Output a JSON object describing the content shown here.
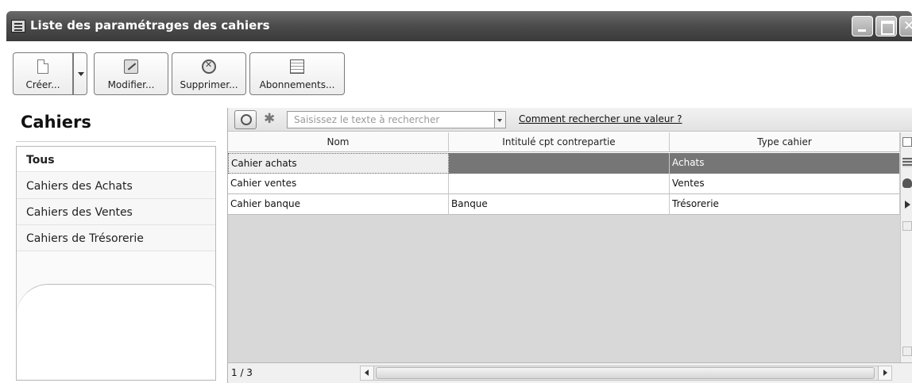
{
  "window": {
    "title": "Liste des paramétrages des cahiers"
  },
  "toolbar": {
    "create_label": "Créer...",
    "edit_label": "Modifier...",
    "delete_label": "Supprimer...",
    "subscriptions_label": "Abonnements..."
  },
  "sidebar": {
    "title": "Cahiers",
    "items": [
      {
        "label": "Tous",
        "active": true
      },
      {
        "label": "Cahiers des Achats",
        "active": false
      },
      {
        "label": "Cahiers des Ventes",
        "active": false
      },
      {
        "label": "Cahiers de Trésorerie",
        "active": false
      }
    ]
  },
  "search": {
    "placeholder": "Saisissez le texte à rechercher",
    "help_link": "Comment rechercher une valeur ?"
  },
  "table": {
    "columns": [
      "Nom",
      "Intitulé cpt contrepartie",
      "Type cahier"
    ],
    "rows": [
      {
        "nom": "Cahier achats",
        "intitule": "",
        "type": "Achats",
        "selected": true
      },
      {
        "nom": "Cahier ventes",
        "intitule": "",
        "type": "Ventes",
        "selected": false
      },
      {
        "nom": "Cahier banque",
        "intitule": "Banque",
        "type": "Trésorerie",
        "selected": false
      }
    ]
  },
  "footer": {
    "pager": "1 / 3"
  }
}
